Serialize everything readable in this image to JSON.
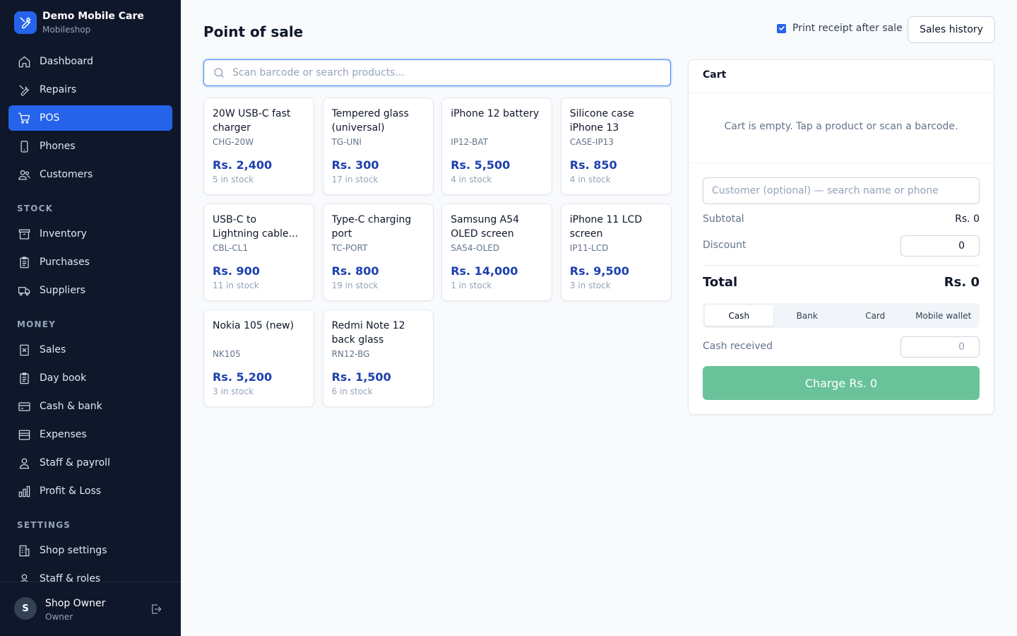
{
  "brand": {
    "title": "Demo Mobile Care",
    "subtitle": "Mobileshop"
  },
  "nav": {
    "main": [
      {
        "label": "Dashboard",
        "icon": "home-icon"
      },
      {
        "label": "Repairs",
        "icon": "wrench-icon"
      },
      {
        "label": "POS",
        "icon": "cart-icon",
        "active": true
      },
      {
        "label": "Phones",
        "icon": "phone-icon"
      },
      {
        "label": "Customers",
        "icon": "users-icon"
      }
    ],
    "stock_heading": "STOCK",
    "stock": [
      {
        "label": "Inventory",
        "icon": "archive-icon"
      },
      {
        "label": "Purchases",
        "icon": "clipboard-icon"
      },
      {
        "label": "Suppliers",
        "icon": "truck-icon"
      }
    ],
    "money_heading": "MONEY",
    "money": [
      {
        "label": "Sales",
        "icon": "receipt-icon"
      },
      {
        "label": "Day book",
        "icon": "book-icon"
      },
      {
        "label": "Cash & bank",
        "icon": "credit-card-icon"
      },
      {
        "label": "Expenses",
        "icon": "wallet-icon"
      },
      {
        "label": "Staff & payroll",
        "icon": "user-icon"
      },
      {
        "label": "Profit & Loss",
        "icon": "bar-chart-icon"
      }
    ],
    "settings_heading": "SETTINGS",
    "settings": [
      {
        "label": "Shop settings",
        "icon": "building-icon"
      },
      {
        "label": "Staff & roles",
        "icon": "user-icon"
      }
    ]
  },
  "user": {
    "initial": "S",
    "name": "Shop Owner",
    "role": "Owner"
  },
  "header": {
    "title": "Point of sale",
    "print_receipt_label": "Print receipt after sale",
    "print_receipt_checked": true,
    "sales_history_label": "Sales history"
  },
  "search": {
    "placeholder": "Scan barcode or search products..."
  },
  "products": [
    {
      "name": "20W USB-C fast charger",
      "sku": "CHG-20W",
      "price": "Rs. 2,400",
      "stock": "5 in stock"
    },
    {
      "name": "Tempered glass (universal)",
      "sku": "TG-UNI",
      "price": "Rs. 300",
      "stock": "17 in stock"
    },
    {
      "name": "iPhone 12 battery",
      "sku": "IP12-BAT",
      "price": "Rs. 5,500",
      "stock": "4 in stock"
    },
    {
      "name": "Silicone case iPhone 13",
      "sku": "CASE-IP13",
      "price": "Rs. 850",
      "stock": "4 in stock"
    },
    {
      "name": "USB-C to Lightning cable...",
      "sku": "CBL-CL1",
      "price": "Rs. 900",
      "stock": "11 in stock"
    },
    {
      "name": "Type-C charging port",
      "sku": "TC-PORT",
      "price": "Rs. 800",
      "stock": "19 in stock"
    },
    {
      "name": "Samsung A54 OLED screen",
      "sku": "SA54-OLED",
      "price": "Rs. 14,000",
      "stock": "1 in stock"
    },
    {
      "name": "iPhone 11 LCD screen",
      "sku": "IP11-LCD",
      "price": "Rs. 9,500",
      "stock": "3 in stock"
    },
    {
      "name": "Nokia 105 (new)",
      "sku": "NK105",
      "price": "Rs. 5,200",
      "stock": "3 in stock"
    },
    {
      "name": "Redmi Note 12 back glass",
      "sku": "RN12-BG",
      "price": "Rs. 1,500",
      "stock": "6 in stock"
    }
  ],
  "cart": {
    "title": "Cart",
    "empty_message": "Cart is empty. Tap a product or scan a barcode.",
    "customer_placeholder": "Customer (optional) — search name or phone",
    "subtotal_label": "Subtotal",
    "subtotal_value": "Rs. 0",
    "discount_label": "Discount",
    "discount_value": "0",
    "total_label": "Total",
    "total_value": "Rs. 0",
    "payment_methods": [
      {
        "label": "Cash",
        "active": true
      },
      {
        "label": "Bank"
      },
      {
        "label": "Card"
      },
      {
        "label": "Mobile wallet"
      }
    ],
    "cash_received_label": "Cash received",
    "cash_received_placeholder": "0",
    "charge_label": "Charge Rs. 0"
  },
  "colors": {
    "sidebar_bg": "#0f172a",
    "accent": "#2563eb",
    "price": "#1e40af",
    "charge_button": "#6ac29a"
  }
}
